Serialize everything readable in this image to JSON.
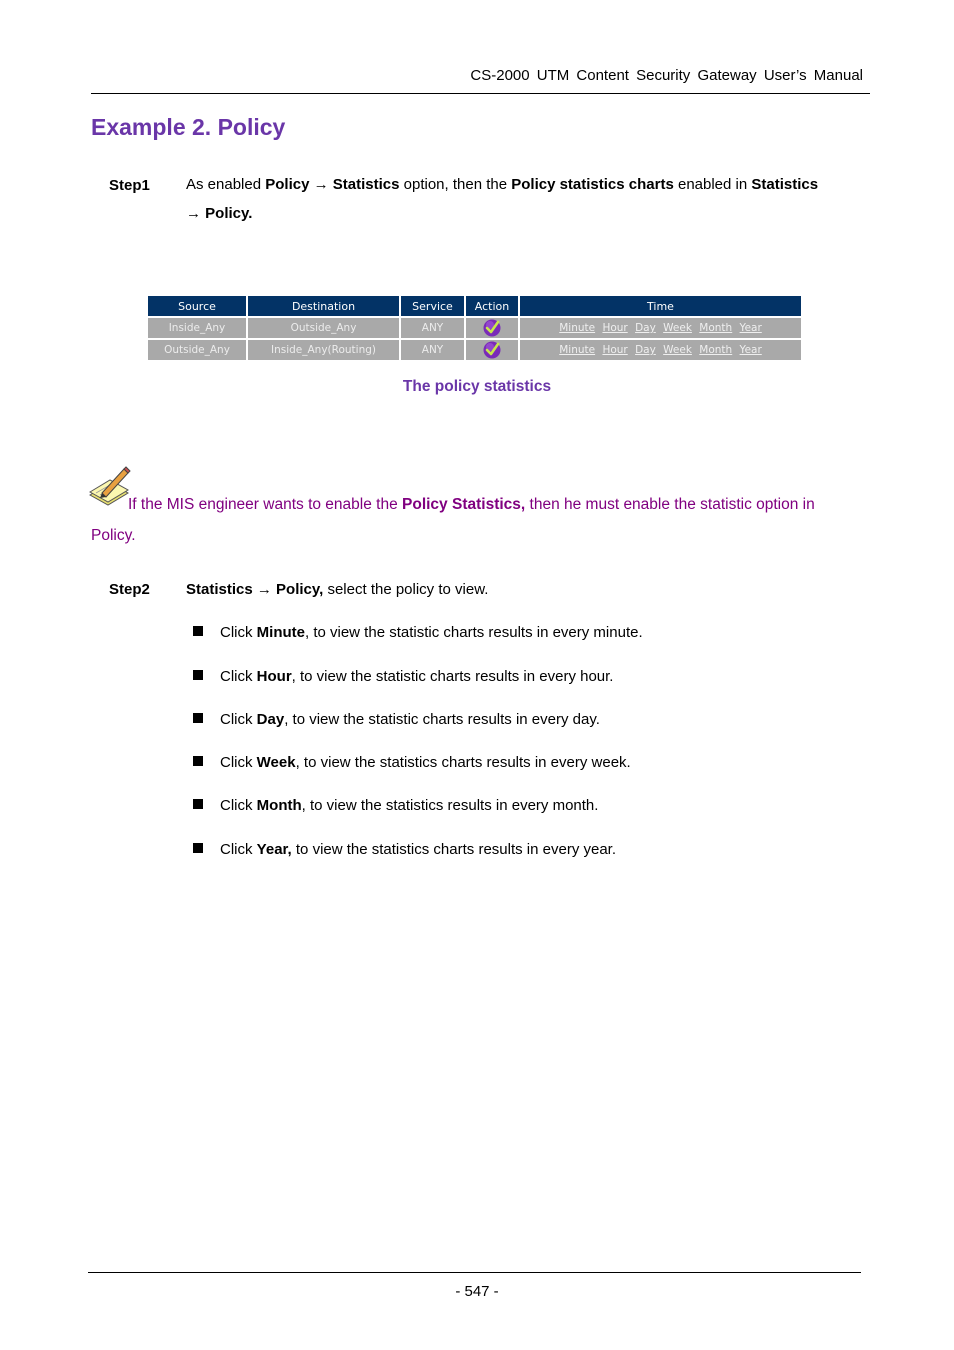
{
  "header": {
    "manual_title": "CS-2000 UTM Content Security Gateway User’s Manual"
  },
  "section": {
    "title": "Example 2. Policy"
  },
  "step1": {
    "label": "Step1",
    "parts": [
      "As enabled ",
      "Policy",
      " → ",
      "Statistics",
      " option, then the ",
      "Policy statistics charts",
      " enabled in ",
      "Statistics",
      " → Policy."
    ]
  },
  "policy_table": {
    "columns": [
      "Source",
      "Destination",
      "Service",
      "Action",
      "Time"
    ],
    "rows": [
      {
        "source": "Inside_Any",
        "destination": "Outside_Any",
        "service": "ANY",
        "action_icon": "check-circle-icon"
      },
      {
        "source": "Outside_Any",
        "destination": "Inside_Any(Routing)",
        "service": "ANY",
        "action_icon": "check-circle-icon"
      }
    ],
    "time_links": [
      "Minute",
      "Hour",
      "Day",
      "Week",
      "Month",
      "Year"
    ],
    "header_bg": "#033366",
    "row_bg": "#a9a9a9"
  },
  "caption": "The policy statistics",
  "note": {
    "icon": "note-pencil-icon",
    "text_before": "If the MIS engineer wants to enable the ",
    "bold": "Policy Statistics,",
    "text_after": " then he must enable the statistic option in Policy.",
    "color": "#800080"
  },
  "step2": {
    "label": "Step2",
    "bold1": "Statistics",
    "arrow": " → ",
    "bold2": "Policy,",
    "rest": " select the policy to view."
  },
  "bullets": [
    {
      "pre": "Click ",
      "bold": "Minute",
      "post": ", to view the statistic charts results in every minute."
    },
    {
      "pre": "Click ",
      "bold": "Hour",
      "post": ", to view the statistic charts results in every hour."
    },
    {
      "pre": "Click ",
      "bold": "Day",
      "post": ", to view the statistic charts results in every day."
    },
    {
      "pre": "Click ",
      "bold": "Week",
      "post": ", to view the statistics charts results in every week."
    },
    {
      "pre": "Click ",
      "bold": "Month",
      "post": ", to view the statistics results in every month."
    },
    {
      "pre": "Click ",
      "bold": "Year,",
      "post": " to view the statistics charts results in every year."
    }
  ],
  "footer": {
    "page_number": "- 547 -"
  }
}
